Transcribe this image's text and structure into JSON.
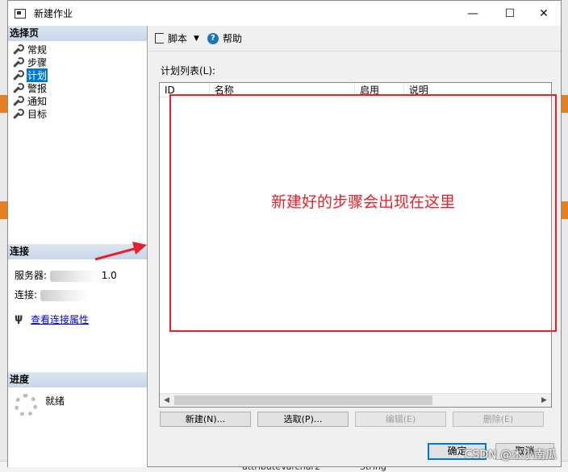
{
  "window": {
    "title": "新建作业"
  },
  "titlebar_buttons": {
    "min": "—",
    "max": "☐",
    "close": "✕"
  },
  "sidebar": {
    "select_page_header": "选择页",
    "items": [
      {
        "label": "常规"
      },
      {
        "label": "步骤"
      },
      {
        "label": "计划",
        "selected": true
      },
      {
        "label": "警报"
      },
      {
        "label": "通知"
      },
      {
        "label": "目标"
      }
    ],
    "connection_header": "连接",
    "server_label": "服务器:",
    "server_value_tail": "1.0",
    "connection_label": "连接:",
    "view_connection_props": "查看连接属性",
    "progress_header": "进度",
    "progress_status": "就绪"
  },
  "toolbar": {
    "script_label": "脚本",
    "help_label": "帮助"
  },
  "schedule": {
    "list_label": "计划列表(L):",
    "columns": [
      "ID",
      "名称",
      "启用",
      "说明"
    ],
    "rows": []
  },
  "annotation": {
    "text": "新建好的步骤会出现在这里",
    "color": "#e8202a"
  },
  "actions": {
    "new_label": "新建(N)...",
    "pick_label": "选取(P)...",
    "edit_label": "编辑(E)",
    "delete_label": "删除(E)"
  },
  "dialog": {
    "ok_label": "确定",
    "cancel_label": "取消"
  },
  "background": {
    "code_snippet": "attributeVarchar2",
    "type_snippet": "String"
  },
  "watermark": "CSDN @木小南瓜"
}
